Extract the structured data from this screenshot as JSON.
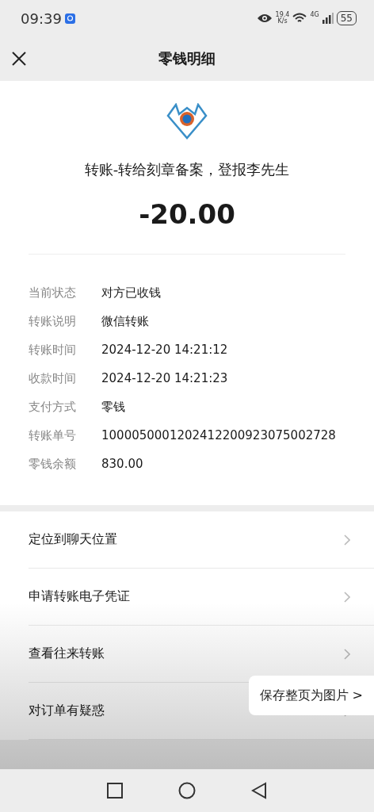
{
  "status_bar": {
    "time": "09:39",
    "speed_value": "19.4",
    "speed_unit": "K/s",
    "network": "4G",
    "battery": "55"
  },
  "header": {
    "title": "零钱明细"
  },
  "summary": {
    "description": "转账-转给刻章备案，登报李先生",
    "amount": "-20.00"
  },
  "details": [
    {
      "label": "当前状态",
      "value": "对方已收钱"
    },
    {
      "label": "转账说明",
      "value": "微信转账"
    },
    {
      "label": "转账时间",
      "value": "2024-12-20 14:21:12"
    },
    {
      "label": "收款时间",
      "value": "2024-12-20 14:21:23"
    },
    {
      "label": "支付方式",
      "value": "零钱"
    },
    {
      "label": "转账单号",
      "value": "1000050001202412200923075002728"
    },
    {
      "label": "零钱余额",
      "value": "830.00"
    }
  ],
  "actions": [
    {
      "label": "定位到聊天位置"
    },
    {
      "label": "申请转账电子凭证"
    },
    {
      "label": "查看往来转账"
    },
    {
      "label": "对订单有疑惑"
    }
  ],
  "save_button": {
    "label": "保存整页为图片 >"
  }
}
